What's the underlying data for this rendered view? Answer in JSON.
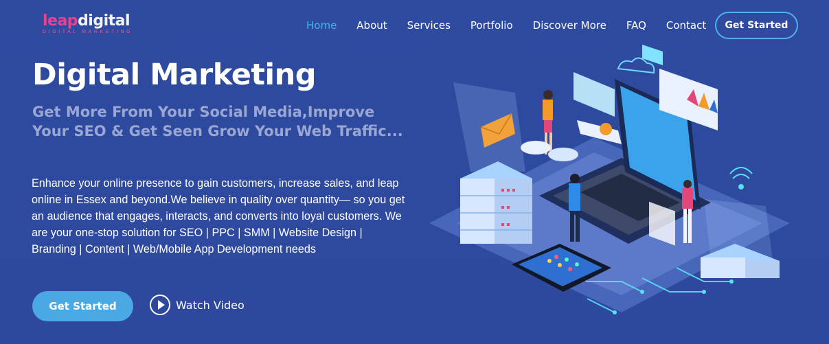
{
  "header": {
    "logo_leap": "leap",
    "logo_digital": "digital",
    "logo_sub": "DIGITAL MARKETING",
    "nav": [
      {
        "label": "Home",
        "active": true
      },
      {
        "label": "About"
      },
      {
        "label": "Services"
      },
      {
        "label": "Portfolio"
      },
      {
        "label": "Discover More"
      },
      {
        "label": "FAQ"
      },
      {
        "label": "Contact"
      }
    ],
    "cta_label": "Get Started"
  },
  "hero": {
    "title": "Digital Marketing",
    "subtitle": "Get More From Your Social Media,Improve Your SEO & Get Seen Grow Your Web Traffic...",
    "body": "Enhance your online presence to gain customers, increase sales, and leap online in Essex and beyond.We believe in quality over quantity— so you get an audience that engages, interacts, and converts into loyal customers. We are your one-stop solution for SEO | PPC | SMM | Website Design | Branding | Content | Web/Mobile App Development needs",
    "primary_button": "Get Started",
    "watch_video": "Watch Video"
  },
  "colors": {
    "background": "#2e4a9e",
    "accent": "#4aa8e4",
    "nav_active": "#49b4ee",
    "logo_pink": "#e8418e"
  }
}
